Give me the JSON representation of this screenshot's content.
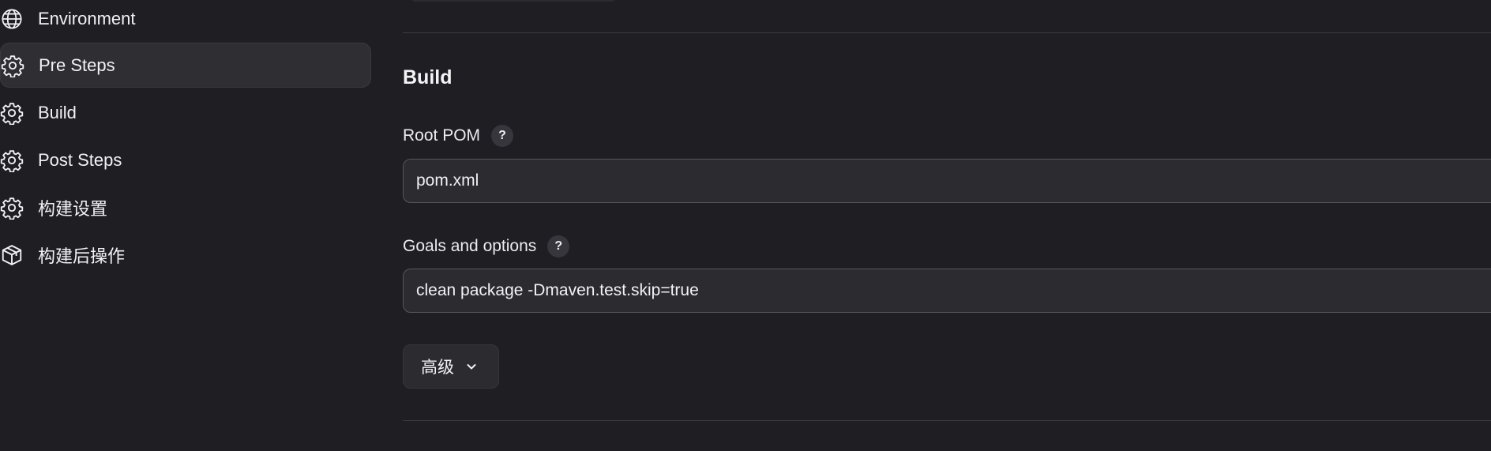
{
  "sidebar": {
    "items": [
      {
        "label": "Environment",
        "icon": "globe-icon",
        "active": false
      },
      {
        "label": "Pre Steps",
        "icon": "gear-icon",
        "active": true
      },
      {
        "label": "Build",
        "icon": "gear-icon",
        "active": false
      },
      {
        "label": "Post Steps",
        "icon": "gear-icon",
        "active": false
      },
      {
        "label": "构建设置",
        "icon": "gear-icon",
        "active": false
      },
      {
        "label": "构建后操作",
        "icon": "package-icon",
        "active": false
      }
    ]
  },
  "main": {
    "section_title": "Build",
    "root_pom": {
      "label": "Root POM",
      "help": "?",
      "value": "pom.xml"
    },
    "goals": {
      "label": "Goals and options",
      "help": "?",
      "value": "clean package -Dmaven.test.skip=true"
    },
    "advanced_button": {
      "label": "高级",
      "icon": "chevron-down-icon"
    }
  },
  "colors": {
    "background": "#1f1f23",
    "input_background": "#2b2b30",
    "active_item_background": "#2e2e33",
    "divider": "#3a3a40"
  }
}
